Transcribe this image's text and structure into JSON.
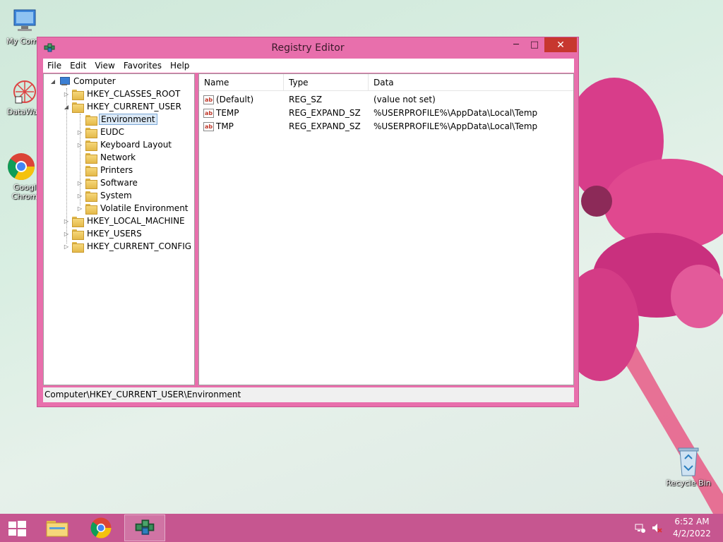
{
  "desktop": {
    "icons": [
      {
        "label": "My Comp"
      },
      {
        "label": "DataWag"
      },
      {
        "label": "Googl Chrom"
      },
      {
        "label": "Recycle Bin"
      }
    ]
  },
  "window": {
    "title": "Registry Editor",
    "controls": {
      "minimize": "─",
      "maximize": "□",
      "close": "✕"
    },
    "menu": [
      "File",
      "Edit",
      "View",
      "Favorites",
      "Help"
    ],
    "tree": {
      "root": "Computer",
      "hives": [
        "HKEY_CLASSES_ROOT",
        "HKEY_CURRENT_USER",
        "HKEY_LOCAL_MACHINE",
        "HKEY_USERS",
        "HKEY_CURRENT_CONFIG"
      ],
      "current_user_children": [
        "Environment",
        "EUDC",
        "Keyboard Layout",
        "Network",
        "Printers",
        "Software",
        "System",
        "Volatile Environment"
      ],
      "selected": "Environment"
    },
    "list": {
      "columns": [
        "Name",
        "Type",
        "Data"
      ],
      "rows": [
        {
          "name": "(Default)",
          "type": "REG_SZ",
          "data": "(value not set)"
        },
        {
          "name": "TEMP",
          "type": "REG_EXPAND_SZ",
          "data": "%USERPROFILE%\\AppData\\Local\\Temp"
        },
        {
          "name": "TMP",
          "type": "REG_EXPAND_SZ",
          "data": "%USERPROFILE%\\AppData\\Local\\Temp"
        }
      ]
    },
    "status": "Computer\\HKEY_CURRENT_USER\\Environment"
  },
  "taskbar": {
    "clock_time": "6:52 AM",
    "clock_date": "4/2/2022",
    "items": [
      "file-explorer-icon",
      "chrome-icon",
      "registry-editor-icon"
    ],
    "tray": [
      "network-icon",
      "volume-muted-icon"
    ]
  },
  "colors": {
    "window_frame": "#e86fac",
    "taskbar": "#c65690",
    "close_button": "#c7372f",
    "selection": "#dbe9f7"
  }
}
